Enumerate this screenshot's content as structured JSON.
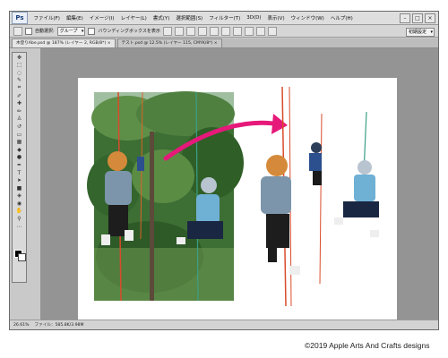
{
  "app": {
    "logo": "Ps"
  },
  "menubar": {
    "items": [
      "ファイル(F)",
      "編集(E)",
      "イメージ(I)",
      "レイヤー(L)",
      "書式(Y)",
      "選択範囲(S)",
      "フィルター(T)",
      "3D(D)",
      "表示(V)",
      "ウィンドウ(W)",
      "ヘルプ(H)"
    ]
  },
  "options": {
    "auto_select_label": "自動選択:",
    "auto_select_value": "グループ",
    "bounding_label": "バウンディングボックスを表示",
    "workspace_value": "初期設定"
  },
  "tabs": [
    {
      "label": "木登りAbe.psd @ 187% (レイヤー 2, RGB/8*) ×",
      "active": true
    },
    {
      "label": "テスト.psd @ 12.5% (レイヤー 115, CMYK/8*) ×",
      "active": false
    }
  ],
  "status": {
    "zoom": "26.61%",
    "file_info": "ファイル：585.8K/3.98M"
  },
  "copyright": "©2019 Apple Arts And Crafts designs"
}
